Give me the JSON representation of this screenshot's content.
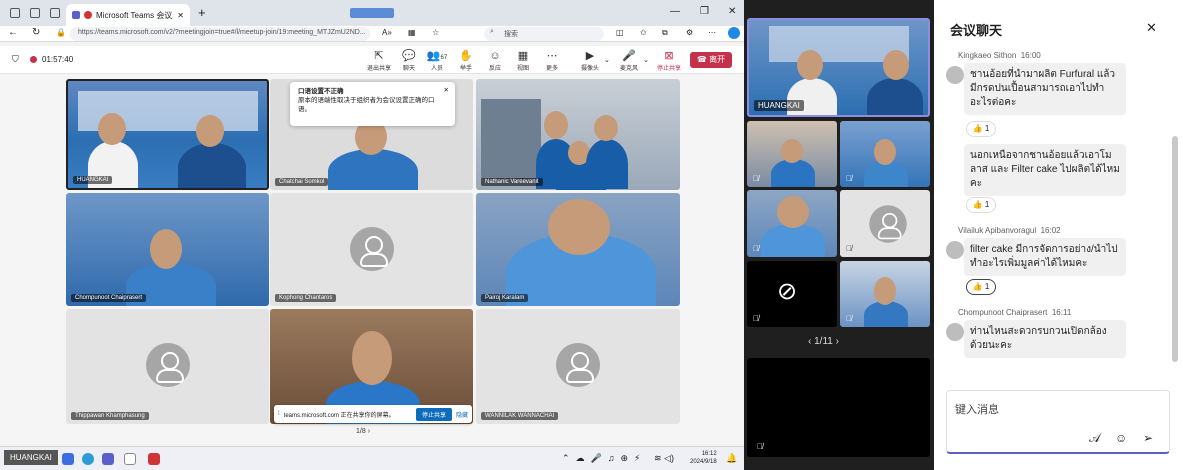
{
  "browser": {
    "tab_title": "Microsoft Teams 会议 | Mic",
    "url": "https://teams.microsoft.com/v2/?meetingjoin=true#/l/meetup-join/19:meeting_MTJZmU2ND...",
    "search_placeholder": "搜索"
  },
  "meeting": {
    "timer": "01:57:40",
    "toolbar": [
      {
        "label": "退出共享",
        "icon": "exit-share-icon"
      },
      {
        "label": "聊天",
        "icon": "chat-icon"
      },
      {
        "label": "人员",
        "icon": "people-icon"
      },
      {
        "label": "举手",
        "icon": "raise-hand-icon"
      },
      {
        "label": "反应",
        "icon": "reaction-icon"
      },
      {
        "label": "视图",
        "icon": "view-icon"
      },
      {
        "label": "更多",
        "icon": "more-icon"
      },
      {
        "label": "摄像头",
        "icon": "camera-icon"
      },
      {
        "label": "麦克风",
        "icon": "mic-icon"
      },
      {
        "label": "停止共享",
        "icon": "stop-share-icon"
      }
    ],
    "people_count": "67",
    "leave_label": "离开",
    "tooltip": {
      "title": "口语设置不正确",
      "body": "原本的语端性取决于组织者为会议设置正确的口语。"
    },
    "tiles": [
      {
        "name": "HUANGKAI"
      },
      {
        "name": "Chatchai Somkol"
      },
      {
        "name": "Nathanic Vareevanit"
      },
      {
        "name": "Chompunoot Chaiprasert"
      },
      {
        "name": "Kophong Chantaros"
      },
      {
        "name": "Pairoj Karalam"
      },
      {
        "name": "Thippawan Khamphasung"
      },
      {
        "name": ""
      },
      {
        "name": "WANNILAK WANNACHAI"
      }
    ],
    "share_banner": {
      "text": "teams.microsoft.com 正在共享你的屏幕。",
      "stop": "停止共享",
      "hide": "隐藏"
    },
    "page": "1/8"
  },
  "strip": {
    "main_name": "HUANGKAI",
    "page": "1/11"
  },
  "taskbar": {
    "user": "HUANGKAI",
    "time": "16:12",
    "date": "2024/9/18"
  },
  "chat": {
    "title": "会议聊天",
    "input_placeholder": "键入消息",
    "messages": [
      {
        "author": "Kingkaeo Sithon",
        "time": "16:00"
      },
      {
        "text": "ชานอ้อยที่นำมาผลิต Furfural แล้วมีกรดปนเปื้อนสามารถเอาไปทำอะไรต่อคะ",
        "react": "1"
      },
      {
        "text": "นอกเหนือจากชานอ้อยแล้วเอาโมลาส และ Filter cake ไปผลิตได้ไหมคะ",
        "react": "1"
      },
      {
        "author": "Vilailuk Apibanvoragul",
        "time": "16:02"
      },
      {
        "text": "filter cake มีการจัดการอย่าง/นำไปทำอะไรเพิ่มมูลค่าได้ไหมคะ",
        "react": "1"
      },
      {
        "author": "Chompunoot Chaiprasert",
        "time": "16:11"
      },
      {
        "text": "ท่านไหนสะดวกรบกวนเปิดกล้องด้วยนะคะ"
      }
    ]
  },
  "colors": {
    "accent": "#5b5fc7",
    "leave": "#c4314b",
    "share": "#0f6cbd"
  }
}
